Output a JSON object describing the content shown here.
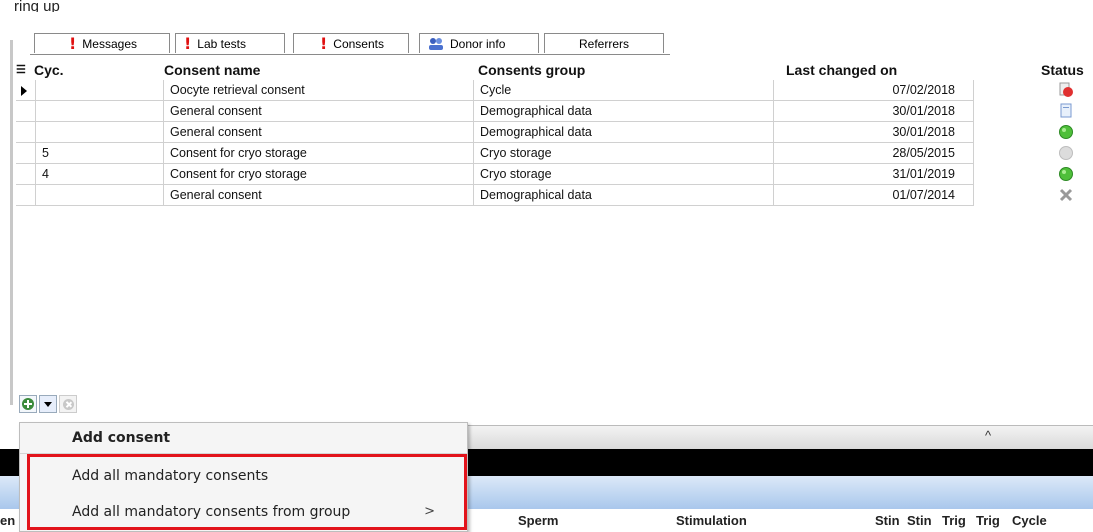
{
  "top_cut_text": "ring up",
  "tabs": [
    {
      "label": "Messages",
      "icon": "exclamation-icon"
    },
    {
      "label": "Lab tests",
      "icon": "exclamation-icon"
    },
    {
      "label": "Consents",
      "icon": "exclamation-icon"
    },
    {
      "label": "Donor info",
      "icon": "donor-icon"
    },
    {
      "label": "Referrers",
      "icon": ""
    }
  ],
  "grid": {
    "headers": {
      "cycle": "Cyc.",
      "name": "Consent name",
      "group": "Consents group",
      "date": "Last changed on",
      "status": "Status"
    },
    "rows": [
      {
        "cycle": "",
        "name": "Oocyte retrieval consent",
        "group": "Cycle",
        "date": "07/02/2018",
        "status": "red-document-icon"
      },
      {
        "cycle": "",
        "name": "General consent",
        "group": "Demographical data",
        "date": "30/01/2018",
        "status": "blue-document-icon"
      },
      {
        "cycle": "",
        "name": "General consent",
        "group": "Demographical data",
        "date": "30/01/2018",
        "status": "green-check-icon"
      },
      {
        "cycle": "5",
        "name": "Consent for cryo storage",
        "group": "Cryo storage",
        "date": "28/05/2015",
        "status": "gray-circle-icon"
      },
      {
        "cycle": "4",
        "name": "Consent for cryo storage",
        "group": "Cryo storage",
        "date": "31/01/2019",
        "status": "green-check-icon"
      },
      {
        "cycle": "",
        "name": "General consent",
        "group": "Demographical data",
        "date": "01/07/2014",
        "status": "gray-x-icon"
      }
    ]
  },
  "menu": {
    "items": [
      {
        "label": "Add consent"
      },
      {
        "label": "Add all mandatory consents"
      },
      {
        "label": "Add all mandatory consents from group",
        "submenu_arrow": ">"
      }
    ]
  },
  "bottom_columns": [
    "en",
    "Sperm",
    "Stimulation",
    "Stin",
    "Stin",
    "Trig",
    "Trig",
    "Cycle"
  ],
  "colors": {
    "highlight": "#e2131b",
    "alert": "#e01010"
  }
}
